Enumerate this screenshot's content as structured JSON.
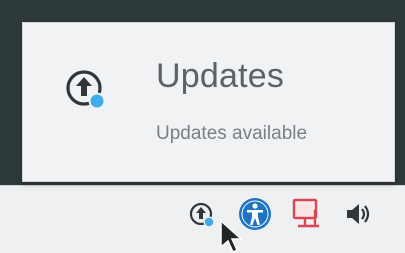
{
  "tooltip": {
    "title": "Updates",
    "subtitle": "Updates available",
    "icon": "updates-icon"
  },
  "tray": {
    "items": [
      {
        "name": "updates-icon"
      },
      {
        "name": "accessibility-icon"
      },
      {
        "name": "network-disconnected-icon"
      },
      {
        "name": "volume-icon"
      }
    ]
  },
  "colors": {
    "desktop_bg": "#2e3a3a",
    "panel_bg": "#eff0f1",
    "tooltip_bg": "#f1f2f3",
    "accent_blue": "#3daee9",
    "accessibility_blue": "#1d74c7",
    "network_red": "#da4453",
    "icon_dark": "#31363b"
  }
}
